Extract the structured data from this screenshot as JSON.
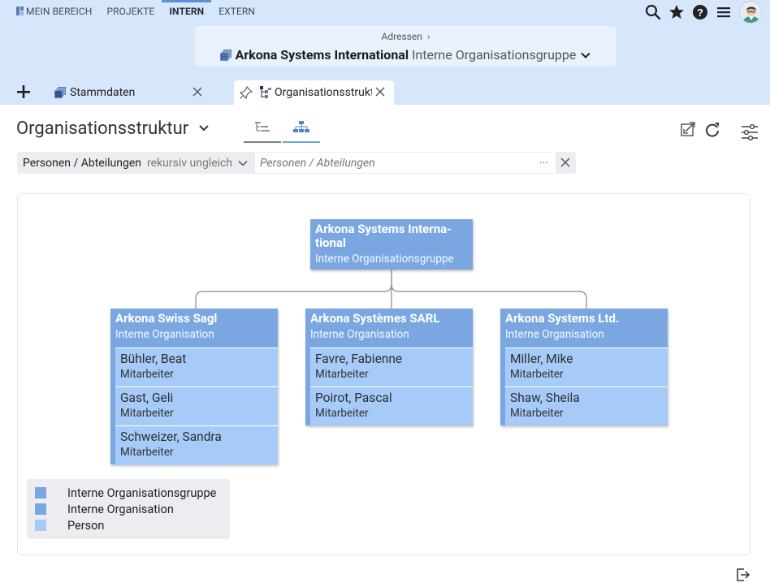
{
  "topnav": {
    "items": [
      {
        "label": "MEIN BEREICH",
        "active": false
      },
      {
        "label": "PROJEKTE",
        "active": false
      },
      {
        "label": "INTERN",
        "active": true
      },
      {
        "label": "EXTERN",
        "active": false
      }
    ],
    "icons": [
      "search-icon",
      "star-icon",
      "help-icon",
      "menu-icon",
      "user-avatar"
    ]
  },
  "header": {
    "breadcrumb": "Adressen",
    "breadcrumb_sep": "›",
    "entity_name": "Arkona Systems International",
    "entity_type": "Interne Organisationsgruppe"
  },
  "tabs": [
    {
      "label": "Stammdaten"
    },
    {
      "label": "Organisationsstruktur"
    }
  ],
  "page": {
    "title": "Organisationsstruktur"
  },
  "filter": {
    "field_label": "Personen / Abteilungen",
    "operator": "rekursiv ungleich",
    "placeholder": "Personen / Abteilungen",
    "more": "···"
  },
  "org": {
    "root": {
      "name": "Arkona Systems Interna-tional",
      "name_line1": "Arkona Systems Interna-",
      "name_line2": "tional",
      "type": "Interne Organisationsgruppe"
    },
    "units": [
      {
        "name": "Arkona Swiss Sagl",
        "type": "Interne Organisation",
        "people": [
          {
            "name": "Bühler, Beat",
            "role": "Mitarbeiter"
          },
          {
            "name": "Gast, Geli",
            "role": "Mitarbeiter"
          },
          {
            "name": "Schweizer, Sandra",
            "role": "Mitarbeiter"
          }
        ]
      },
      {
        "name": "Arkona Systèmes SARL",
        "type": "Interne Organisation",
        "people": [
          {
            "name": "Favre, Fabienne",
            "role": "Mitarbeiter"
          },
          {
            "name": "Poirot, Pascal",
            "role": "Mitarbeiter"
          }
        ]
      },
      {
        "name": "Arkona Systems Ltd.",
        "type": "Interne Organisation",
        "people": [
          {
            "name": "Miller, Mike",
            "role": "Mitarbeiter"
          },
          {
            "name": "Shaw, Sheila",
            "role": "Mitarbeiter"
          }
        ]
      }
    ]
  },
  "legend": [
    {
      "label": "Interne Organisationsgruppe",
      "color": "#7aa7e2"
    },
    {
      "label": "Interne Organisation",
      "color": "#7aa7e2"
    },
    {
      "label": "Person",
      "color": "#a6cbf8"
    }
  ],
  "colors": {
    "header_bg": "#d6e6fb",
    "accent": "#5b8fd6",
    "org_node": "#7aa7e2",
    "person_node": "#a6cbf8"
  }
}
